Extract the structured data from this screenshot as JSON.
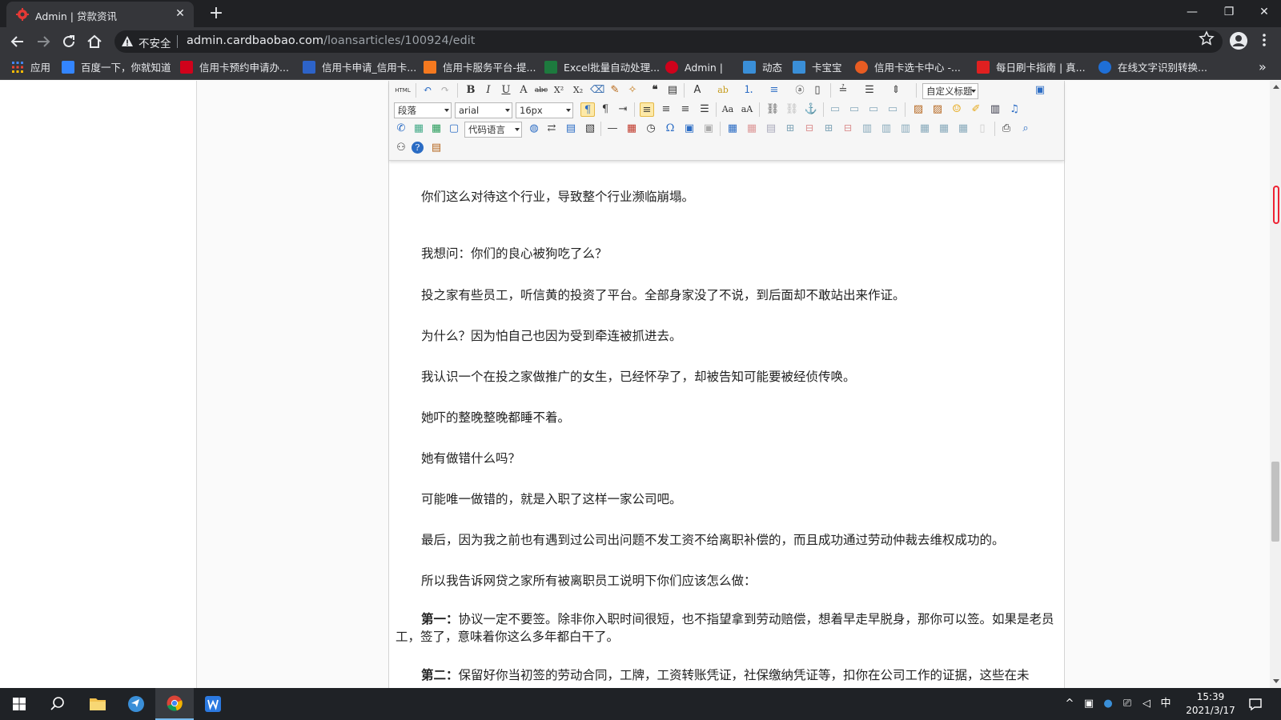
{
  "browser": {
    "tab_title": "Admin | 贷款资讯",
    "tab_close": "✕",
    "new_tab": "+",
    "window_controls": {
      "minimize": "—",
      "restore": "❐",
      "close": "✕"
    },
    "security_label": "不安全",
    "url_host": "admin.cardbaobao.com",
    "url_path": "/loansarticles/100924/edit",
    "more_bookmarks": "»"
  },
  "bookmarks": [
    {
      "label": "应用",
      "icon": "apps-grid-icon",
      "color": "#4285f4"
    },
    {
      "label": "百度一下，你就知道",
      "icon": "baidu-paw-icon",
      "color": "#3385ff"
    },
    {
      "label": "信用卡预约申请办...",
      "icon": "envelope-red-icon",
      "color": "#d0021b"
    },
    {
      "label": "信用卡申请_信用卡...",
      "icon": "blue-logo-icon",
      "color": "#2d63c8"
    },
    {
      "label": "信用卡服务平台-提...",
      "icon": "orange-card-icon",
      "color": "#f5791f"
    },
    {
      "label": "Excel批量自动处理...",
      "icon": "excel-icon",
      "color": "#1d7a3e"
    },
    {
      "label": "Admin |",
      "icon": "admin-gear-icon",
      "color": "#d0021b"
    },
    {
      "label": "动态",
      "icon": "bird-icon",
      "color": "#3a8fd8"
    },
    {
      "label": "卡宝宝",
      "icon": "bird-icon",
      "color": "#3a8fd8"
    },
    {
      "label": "信用卡选卡中心 -...",
      "icon": "red-ring-icon",
      "color": "#e85c22"
    },
    {
      "label": "每日刷卡指南 | 真...",
      "icon": "red-flag-icon",
      "color": "#e02020"
    },
    {
      "label": "在线文字识别转换...",
      "icon": "blue-gear-icon",
      "color": "#1f6fd6"
    }
  ],
  "editor": {
    "toolbar": {
      "html_label": "HTML",
      "paragraph_select": "段落",
      "font_select": "arial",
      "size_select": "16px",
      "custom_heading_select": "自定义标题",
      "code_language_select": "代码语言"
    },
    "paragraphs": [
      "你们这么对待这个行业，导致整个行业濒临崩塌。",
      "我想问：你们的良心被狗吃了么？",
      "投之家有些员工，听信黄的投资了平台。全部身家没了不说，到后面却不敢站出来作证。",
      "为什么？因为怕自己也因为受到牵连被抓进去。",
      "我认识一个在投之家做推广的女生，已经怀孕了，却被告知可能要被经侦传唤。",
      "她吓的整晚整晚都睡不着。",
      "她有做错什么吗？",
      "可能唯一做错的，就是入职了这样一家公司吧。",
      "最后，因为我之前也有遇到过公司出问题不发工资不给离职补偿的，而且成功通过劳动仲裁去维权成功的。",
      "所以我告诉网贷之家所有被离职员工说明下你们应该怎么做："
    ],
    "point1_bold": "第一：",
    "point1_text": "协议一定不要签。除非你入职时间很短，也不指望拿到劳动赔偿，想着早走早脱身，那你可以签。如果是老员工，签了，意味着你这么多年都白干了。",
    "point2_bold": "第二：",
    "point2_text": "保留好你当初签的劳动合同，工牌，工资转账凭证，社保缴纳凭证等，扣你在公司工作的证据，这些在未"
  },
  "taskbar": {
    "ime": "中",
    "time": "15:39",
    "date": "2021/3/17"
  }
}
